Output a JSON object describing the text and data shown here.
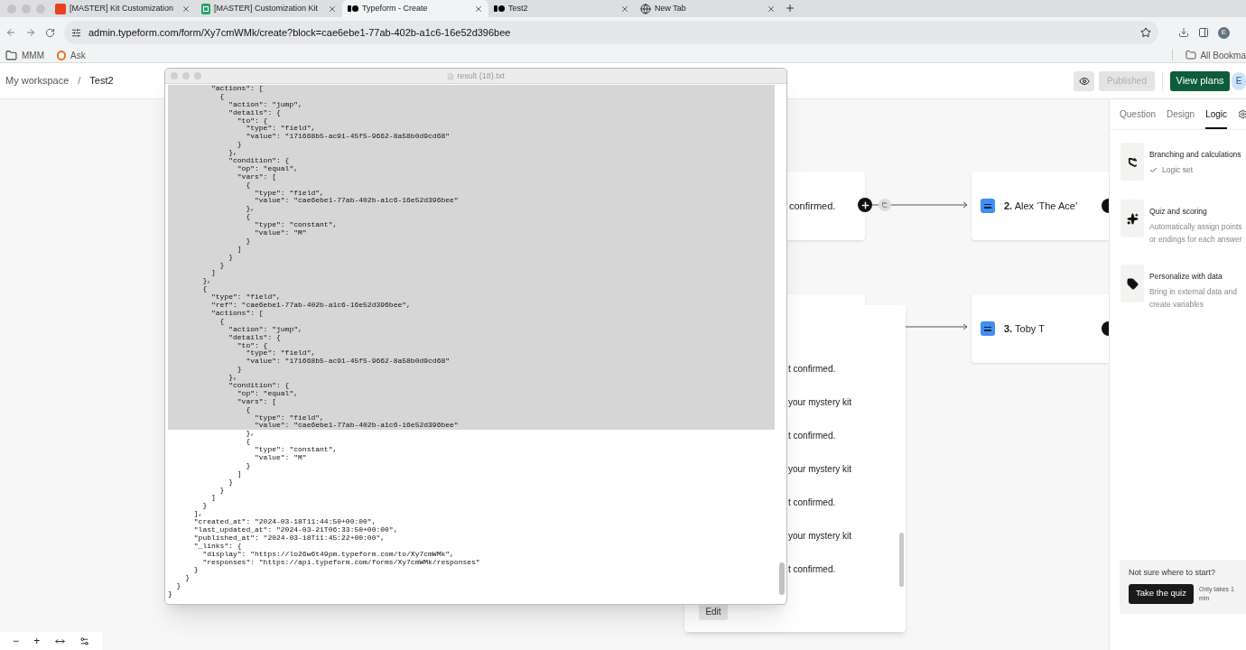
{
  "browser": {
    "tabs": [
      {
        "title": "[MASTER] Kit Customization",
        "kind": "square",
        "selected": false
      },
      {
        "title": "[MASTER] Customization Kit",
        "kind": "sheet",
        "selected": false
      },
      {
        "title": "Typeform - Create",
        "kind": "typeform",
        "selected": true
      },
      {
        "title": "Test2",
        "kind": "typeform",
        "selected": false
      },
      {
        "title": "New Tab",
        "kind": "globe",
        "selected": false
      }
    ],
    "url": "admin.typeform.com/form/Xy7cmWMk/create?block=cae6ebe1-77ab-402b-a1c6-16e52d396bee",
    "profile": "E",
    "bookmarks": [
      {
        "label": "MMM",
        "kind": "folder"
      },
      {
        "label": "Ask",
        "kind": "ask"
      }
    ],
    "all_bookmarks": "All Bookma"
  },
  "header": {
    "breadcrumb": [
      "My workspace",
      "/",
      "Test2"
    ],
    "publish": {
      "label": "Published",
      "disabled": true
    },
    "upgrade": "View plans",
    "avatar": "E"
  },
  "canvas": {
    "nodes": [
      {
        "kind": "partial",
        "text": "confirmed."
      },
      {
        "kind": "question",
        "text": "**2.** Alex ‘The Ace’"
      },
      {
        "kind": "question",
        "text": "**3.** Toby T"
      }
    ],
    "list_items": [
      "t confirmed.",
      "your mystery kit",
      "t confirmed.",
      "your mystery kit",
      "t confirmed.",
      "your mystery kit",
      "t confirmed."
    ],
    "edit": "Edit",
    "zoom_controls": [
      "−",
      "+"
    ]
  },
  "logic_panel": {
    "tabs": [
      {
        "label": "Question",
        "selected": false
      },
      {
        "label": "Design",
        "selected": false
      },
      {
        "label": "Logic",
        "selected": true
      }
    ],
    "features": [
      {
        "kind": "branch",
        "title": "Branching and calculations",
        "status": "Logic set"
      },
      {
        "kind": "sparkle",
        "title": "Quiz and scoring",
        "description": "Automatically assign points or endings for each answer"
      },
      {
        "kind": "tag",
        "title": "Personalize with data",
        "description": "Bring in external data and create variables"
      }
    ],
    "help": {
      "title": "Not sure where to start?",
      "button": "Take the quiz",
      "note": "Only takes 1 min"
    }
  },
  "text_window": {
    "title": "result (18).txt",
    "lines": [
      {
        "text": "          \"actions\": [",
        "selected": true
      },
      {
        "text": "            {",
        "selected": true
      },
      {
        "text": "              \"action\": \"jump\",",
        "selected": true
      },
      {
        "text": "              \"details\": {",
        "selected": true
      },
      {
        "text": "                \"to\": {",
        "selected": true
      },
      {
        "text": "                  \"type\": \"field\",",
        "selected": true
      },
      {
        "text": "                  \"value\": \"171668b5-ac91-45f5-9662-8a58b0d9cd68\"",
        "selected": true
      },
      {
        "text": "                }",
        "selected": true
      },
      {
        "text": "              },",
        "selected": true
      },
      {
        "text": "              \"condition\": {",
        "selected": true
      },
      {
        "text": "                \"op\": \"equal\",",
        "selected": true
      },
      {
        "text": "                \"vars\": [",
        "selected": true
      },
      {
        "text": "                  {",
        "selected": true
      },
      {
        "text": "                    \"type\": \"field\",",
        "selected": true
      },
      {
        "text": "                    \"value\": \"cae6ebe1-77ab-402b-a1c6-16e52d396bee\"",
        "selected": true
      },
      {
        "text": "                  },",
        "selected": true
      },
      {
        "text": "                  {",
        "selected": true
      },
      {
        "text": "                    \"type\": \"constant\",",
        "selected": true
      },
      {
        "text": "                    \"value\": \"M\"",
        "selected": true
      },
      {
        "text": "                  }",
        "selected": true
      },
      {
        "text": "                ]",
        "selected": true
      },
      {
        "text": "              }",
        "selected": true
      },
      {
        "text": "            }",
        "selected": true
      },
      {
        "text": "          ]",
        "selected": true
      },
      {
        "text": "        },",
        "selected": true
      },
      {
        "text": "        {",
        "selected": true
      },
      {
        "text": "          \"type\": \"field\",",
        "selected": true
      },
      {
        "text": "          \"ref\": \"cae6ebe1-77ab-402b-a1c6-16e52d396bee\",",
        "selected": true
      },
      {
        "text": "          \"actions\": [",
        "selected": true
      },
      {
        "text": "            {",
        "selected": true
      },
      {
        "text": "              \"action\": \"jump\",",
        "selected": true
      },
      {
        "text": "              \"details\": {",
        "selected": true
      },
      {
        "text": "                \"to\": {",
        "selected": true
      },
      {
        "text": "                  \"type\": \"field\",",
        "selected": true
      },
      {
        "text": "                  \"value\": \"171668b5-ac91-45f5-9662-8a58b0d9cd68\"",
        "selected": true
      },
      {
        "text": "                }",
        "selected": true
      },
      {
        "text": "              },",
        "selected": true
      },
      {
        "text": "              \"condition\": {",
        "selected": true
      },
      {
        "text": "                \"op\": \"equal\",",
        "selected": true
      },
      {
        "text": "                \"vars\": [",
        "selected": true
      },
      {
        "text": "                  {",
        "selected": true
      },
      {
        "text": "                    \"type\": \"field\",",
        "selected": true
      },
      {
        "text": "                    \"value\": \"cae6ebe1-77ab-402b-a1c6-16e52d396bee\"",
        "selected": true
      },
      {
        "text": "                  },",
        "selected": false
      },
      {
        "text": "                  {",
        "selected": false
      },
      {
        "text": "                    \"type\": \"constant\",",
        "selected": false
      },
      {
        "text": "                    \"value\": \"M\"",
        "selected": false
      },
      {
        "text": "                  }",
        "selected": false
      },
      {
        "text": "                ]",
        "selected": false
      },
      {
        "text": "              }",
        "selected": false
      },
      {
        "text": "            }",
        "selected": false
      },
      {
        "text": "          ]",
        "selected": false
      },
      {
        "text": "        }",
        "selected": false
      },
      {
        "text": "      ],",
        "selected": false
      },
      {
        "text": "      \"created_at\": \"2024-03-18T11:44:50+00:00\",",
        "selected": false
      },
      {
        "text": "      \"last_updated_at\": \"2024-03-21T06:33:50+00:00\",",
        "selected": false
      },
      {
        "text": "      \"published_at\": \"2024-03-18T11:45:22+00:00\",",
        "selected": false
      },
      {
        "text": "      \"_links\": {",
        "selected": false
      },
      {
        "text": "        \"display\": \"https://lo26w6t49pm.typeform.com/to/Xy7cmWMk\",",
        "selected": false
      },
      {
        "text": "        \"responses\": \"https://api.typeform.com/forms/Xy7cmWMk/responses\"",
        "selected": false
      },
      {
        "text": "      }",
        "selected": false
      },
      {
        "text": "    }",
        "selected": false
      },
      {
        "text": "  }",
        "selected": false
      },
      {
        "text": "}",
        "selected": false
      }
    ]
  }
}
